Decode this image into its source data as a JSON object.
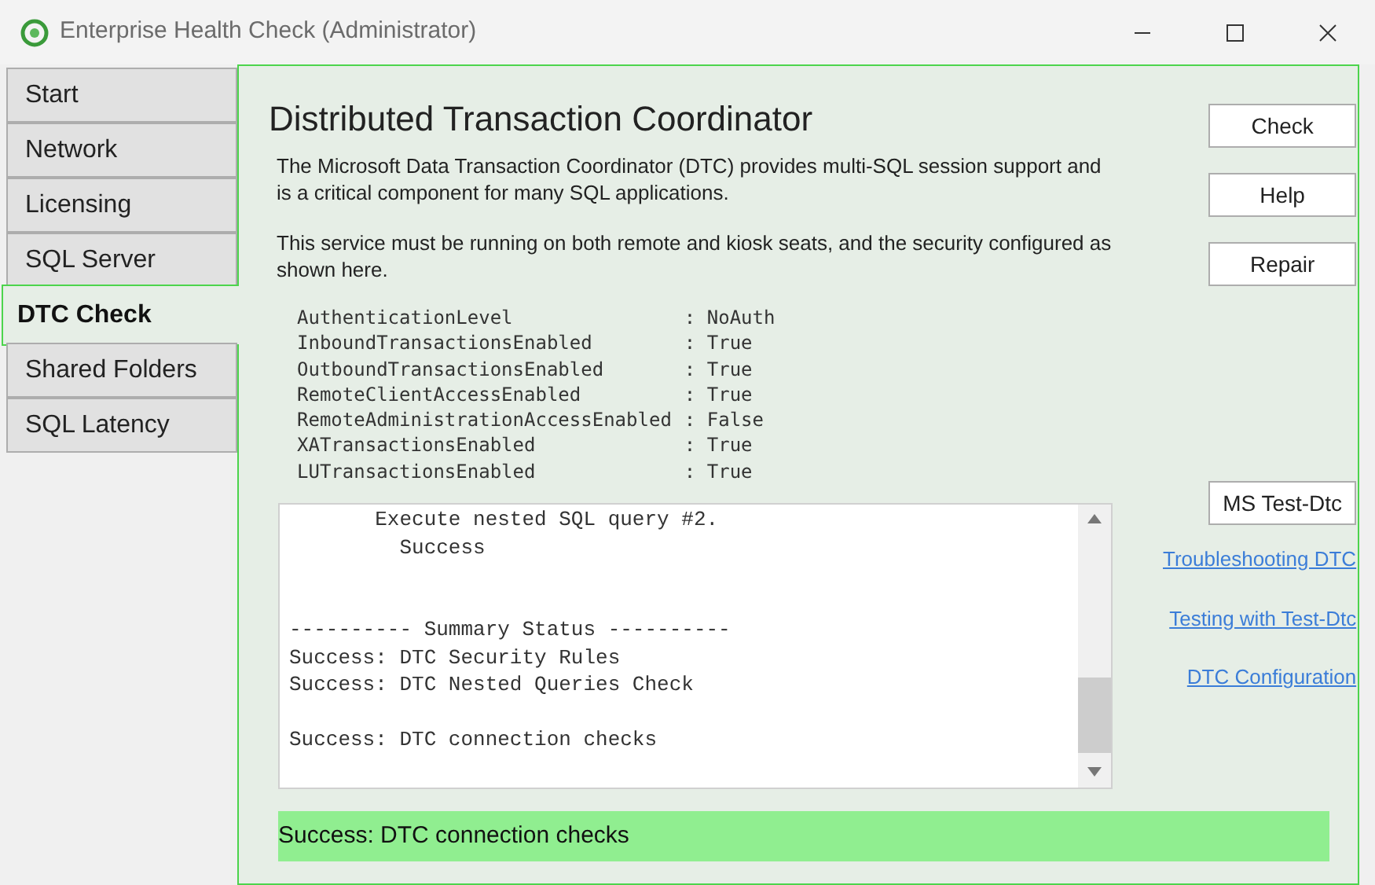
{
  "window": {
    "title": "Enterprise Health Check (Administrator)"
  },
  "tabs": [
    {
      "label": "Start",
      "selected": false
    },
    {
      "label": "Network",
      "selected": false
    },
    {
      "label": "Licensing",
      "selected": false
    },
    {
      "label": "SQL Server",
      "selected": false
    },
    {
      "label": "DTC Check",
      "selected": true
    },
    {
      "label": "Shared Folders",
      "selected": false
    },
    {
      "label": "SQL Latency",
      "selected": false
    }
  ],
  "heading": "Distributed Transaction Coordinator",
  "paragraphs": [
    "The Microsoft Data Transaction Coordinator (DTC) provides multi-SQL session support and is a critical component for many SQL applications.",
    "This service must be running on both remote and kiosk seats, and the security configured as shown here."
  ],
  "settings": [
    {
      "name": "AuthenticationLevel",
      "value": ": NoAuth"
    },
    {
      "name": "InboundTransactionsEnabled",
      "value": ": True"
    },
    {
      "name": "OutboundTransactionsEnabled",
      "value": ": True"
    },
    {
      "name": "RemoteClientAccessEnabled",
      "value": ": True"
    },
    {
      "name": "RemoteAdministrationAccessEnabled",
      "value": ": False"
    },
    {
      "name": "XATransactionsEnabled",
      "value": ": True"
    },
    {
      "name": "LUTransactionsEnabled",
      "value": ": True"
    }
  ],
  "buttons": [
    "Check",
    "Help",
    "Repair"
  ],
  "log": "       Execute nested SQL query #2.\n         Success\n\n\n---------- Summary Status ----------\nSuccess: DTC Security Rules\nSuccess: DTC Nested Queries Check\n\nSuccess: DTC connection checks",
  "test_button": "MS Test-Dtc",
  "links": [
    "Troubleshooting DTC",
    "Testing with Test-Dtc",
    "DTC Configuration"
  ],
  "status": "Success: DTC connection checks"
}
